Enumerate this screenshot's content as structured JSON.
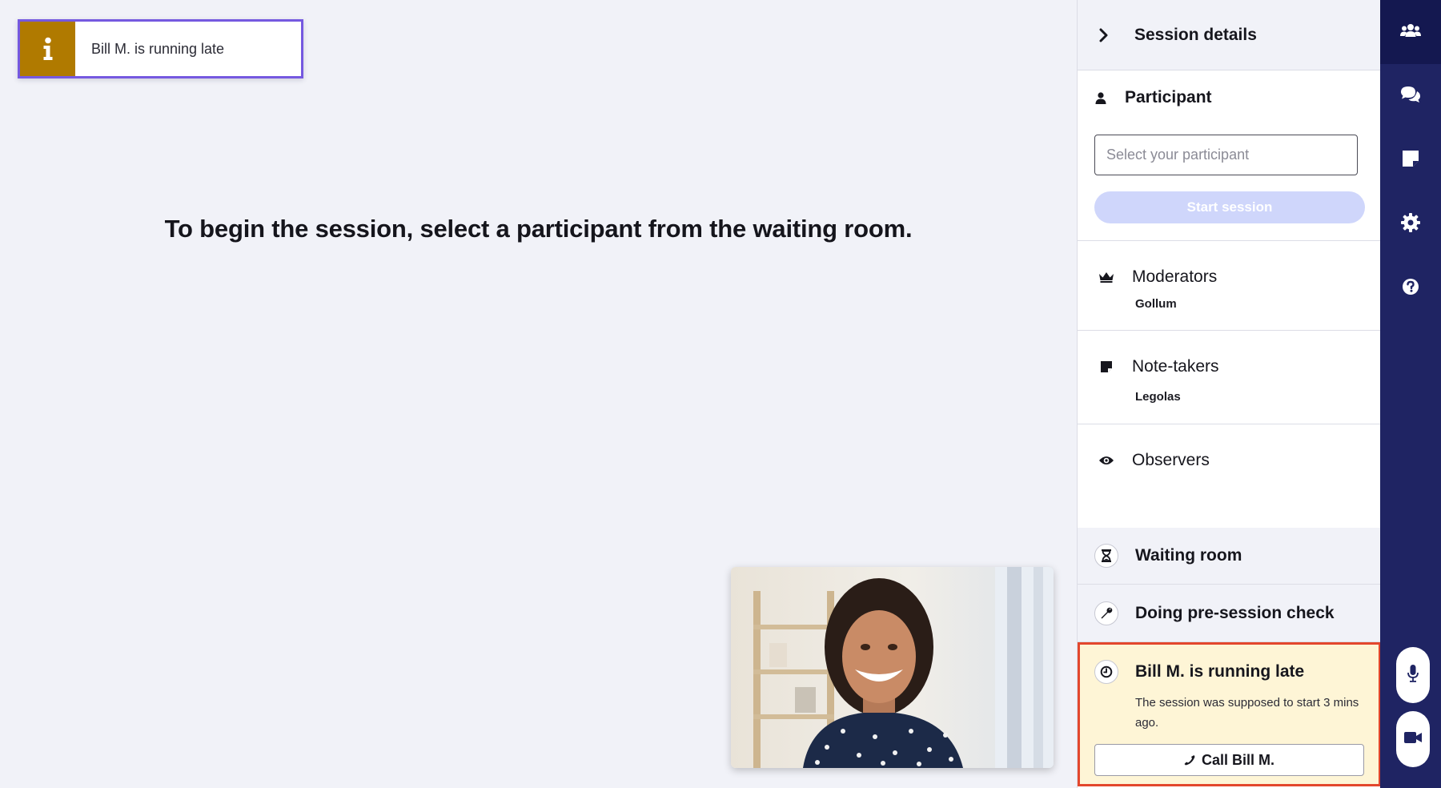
{
  "toast": {
    "message": "Bill M. is running late",
    "icon": "info-icon",
    "accent": "#b07a00",
    "border": "#7559e0"
  },
  "main": {
    "prompt": "To begin the session, select a participant from the waiting room."
  },
  "session_panel": {
    "header_title": "Session details",
    "participant": {
      "title": "Participant",
      "placeholder": "Select your participant",
      "start_label": "Start session"
    },
    "moderators": {
      "title": "Moderators",
      "names": "Gollum"
    },
    "note_takers": {
      "title": "Note-takers",
      "names": "Legolas"
    },
    "observers": {
      "title": "Observers"
    },
    "waiting_room": {
      "title": "Waiting room"
    },
    "pre_check": {
      "title": "Doing pre-session check"
    },
    "late_card": {
      "title": "Bill M. is running late",
      "description": "The session was supposed to start 3 mins ago.",
      "call_label": "Call Bill M.",
      "background": "#fef5d6",
      "border": "#e3472d"
    }
  },
  "rail": {
    "items": [
      "participants-icon",
      "chat-icon",
      "notes-icon",
      "settings-icon",
      "help-icon"
    ],
    "controls": [
      "microphone-icon",
      "camera-icon"
    ],
    "background": "#1f2463"
  }
}
